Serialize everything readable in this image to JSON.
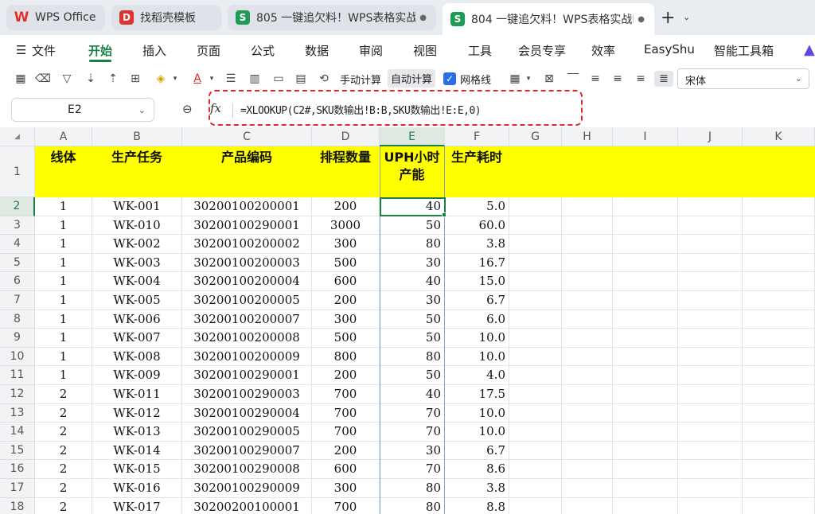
{
  "tabs": [
    {
      "label": "WPS Office",
      "icon": "wps-logo-icon",
      "glyph": "W"
    },
    {
      "label": "找稻壳模板",
      "icon": "daoke-icon",
      "glyph": "D"
    },
    {
      "label": "805 一键追欠料！WPS表格实战M",
      "icon": "sheet-icon",
      "glyph": "S"
    },
    {
      "label": "804 一键追欠料！WPS表格实战M",
      "icon": "sheet-icon",
      "glyph": "S"
    }
  ],
  "menu": {
    "file": "文件",
    "items": [
      "开始",
      "插入",
      "页面",
      "公式",
      "数据",
      "审阅",
      "视图",
      "工具",
      "会员专享",
      "效率",
      "EasyShu",
      "智能工具箱"
    ],
    "active": "开始"
  },
  "toolbar": {
    "manual_calc": "手动计算",
    "auto_calc": "自动计算",
    "gridlines": "网格线",
    "gridlines_checked": true,
    "font_name": "宋体"
  },
  "formula_bar": {
    "cell_ref": "E2",
    "fx": "fx",
    "formula": "=XLOOKUP(C2#,SKU数输出!B:B,SKU数输出!E:E,0)"
  },
  "sheet": {
    "columns": [
      "A",
      "B",
      "C",
      "D",
      "E",
      "F",
      "G",
      "H",
      "I",
      "J",
      "K"
    ],
    "selected_column": "E",
    "selected_row": "2",
    "header_row": {
      "row_number": "1",
      "cells": [
        "线体",
        "生产任务",
        "产品编码",
        "排程数量",
        "UPH小时产能",
        "生产耗时"
      ]
    },
    "rows": [
      {
        "n": "2",
        "a": "1",
        "b": "WK-001",
        "c": "30200100200001",
        "d": "200",
        "e": "40",
        "f": "5.0"
      },
      {
        "n": "3",
        "a": "1",
        "b": "WK-010",
        "c": "30200100290001",
        "d": "3000",
        "e": "50",
        "f": "60.0"
      },
      {
        "n": "4",
        "a": "1",
        "b": "WK-002",
        "c": "30200100200002",
        "d": "300",
        "e": "80",
        "f": "3.8"
      },
      {
        "n": "5",
        "a": "1",
        "b": "WK-003",
        "c": "30200100200003",
        "d": "500",
        "e": "30",
        "f": "16.7"
      },
      {
        "n": "6",
        "a": "1",
        "b": "WK-004",
        "c": "30200100200004",
        "d": "600",
        "e": "40",
        "f": "15.0"
      },
      {
        "n": "7",
        "a": "1",
        "b": "WK-005",
        "c": "30200100200005",
        "d": "200",
        "e": "30",
        "f": "6.7"
      },
      {
        "n": "8",
        "a": "1",
        "b": "WK-006",
        "c": "30200100200007",
        "d": "300",
        "e": "50",
        "f": "6.0"
      },
      {
        "n": "9",
        "a": "1",
        "b": "WK-007",
        "c": "30200100200008",
        "d": "500",
        "e": "50",
        "f": "10.0"
      },
      {
        "n": "10",
        "a": "1",
        "b": "WK-008",
        "c": "30200100200009",
        "d": "800",
        "e": "80",
        "f": "10.0"
      },
      {
        "n": "11",
        "a": "1",
        "b": "WK-009",
        "c": "30200100290001",
        "d": "200",
        "e": "50",
        "f": "4.0"
      },
      {
        "n": "12",
        "a": "2",
        "b": "WK-011",
        "c": "30200100290003",
        "d": "700",
        "e": "40",
        "f": "17.5"
      },
      {
        "n": "13",
        "a": "2",
        "b": "WK-012",
        "c": "30200100290004",
        "d": "700",
        "e": "70",
        "f": "10.0"
      },
      {
        "n": "14",
        "a": "2",
        "b": "WK-013",
        "c": "30200100290005",
        "d": "700",
        "e": "70",
        "f": "10.0"
      },
      {
        "n": "15",
        "a": "2",
        "b": "WK-014",
        "c": "30200100290007",
        "d": "200",
        "e": "30",
        "f": "6.7"
      },
      {
        "n": "16",
        "a": "2",
        "b": "WK-015",
        "c": "30200100290008",
        "d": "600",
        "e": "70",
        "f": "8.6"
      },
      {
        "n": "17",
        "a": "2",
        "b": "WK-016",
        "c": "30200100290009",
        "d": "300",
        "e": "80",
        "f": "3.8"
      },
      {
        "n": "18",
        "a": "2",
        "b": "WK-017",
        "c": "30200200100001",
        "d": "700",
        "e": "80",
        "f": "8.8"
      }
    ]
  },
  "colors": {
    "accent_green": "#1a7f46",
    "header_fill": "#ffff00",
    "highlight_red": "#e0292a"
  }
}
